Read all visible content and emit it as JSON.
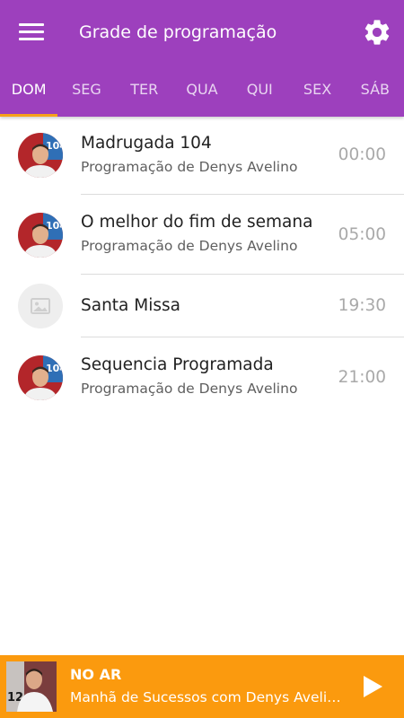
{
  "header": {
    "title": "Grade de programação",
    "menu_icon": "hamburger-menu-icon",
    "settings_icon": "gear-icon",
    "background_color": "#9d40bd",
    "indicator_color": "#f6a11a"
  },
  "tabs": [
    {
      "label": "DOM",
      "active": true
    },
    {
      "label": "SEG",
      "active": false
    },
    {
      "label": "TER",
      "active": false
    },
    {
      "label": "QUA",
      "active": false
    },
    {
      "label": "QUI",
      "active": false
    },
    {
      "label": "SEX",
      "active": false
    },
    {
      "label": "SÁB",
      "active": false
    }
  ],
  "schedule": [
    {
      "title": "Madrugada 104",
      "subtitle": "Programação de Denys Avelino",
      "time": "00:00",
      "avatar": "host-photo"
    },
    {
      "title": "O melhor do fim de semana",
      "subtitle": "Programação de Denys Avelino",
      "time": "05:00",
      "avatar": "host-photo"
    },
    {
      "title": "Santa Missa",
      "subtitle": "",
      "time": "19:30",
      "avatar": "image-placeholder-icon"
    },
    {
      "title": "Sequencia Programada",
      "subtitle": "Programação de Denys Avelino",
      "time": "21:00",
      "avatar": "host-photo"
    }
  ],
  "player": {
    "label": "NO AR",
    "show": "Manhã de Sucessos com Denys Avelino",
    "play_icon": "play-icon",
    "background_color": "#fb9a0e"
  }
}
